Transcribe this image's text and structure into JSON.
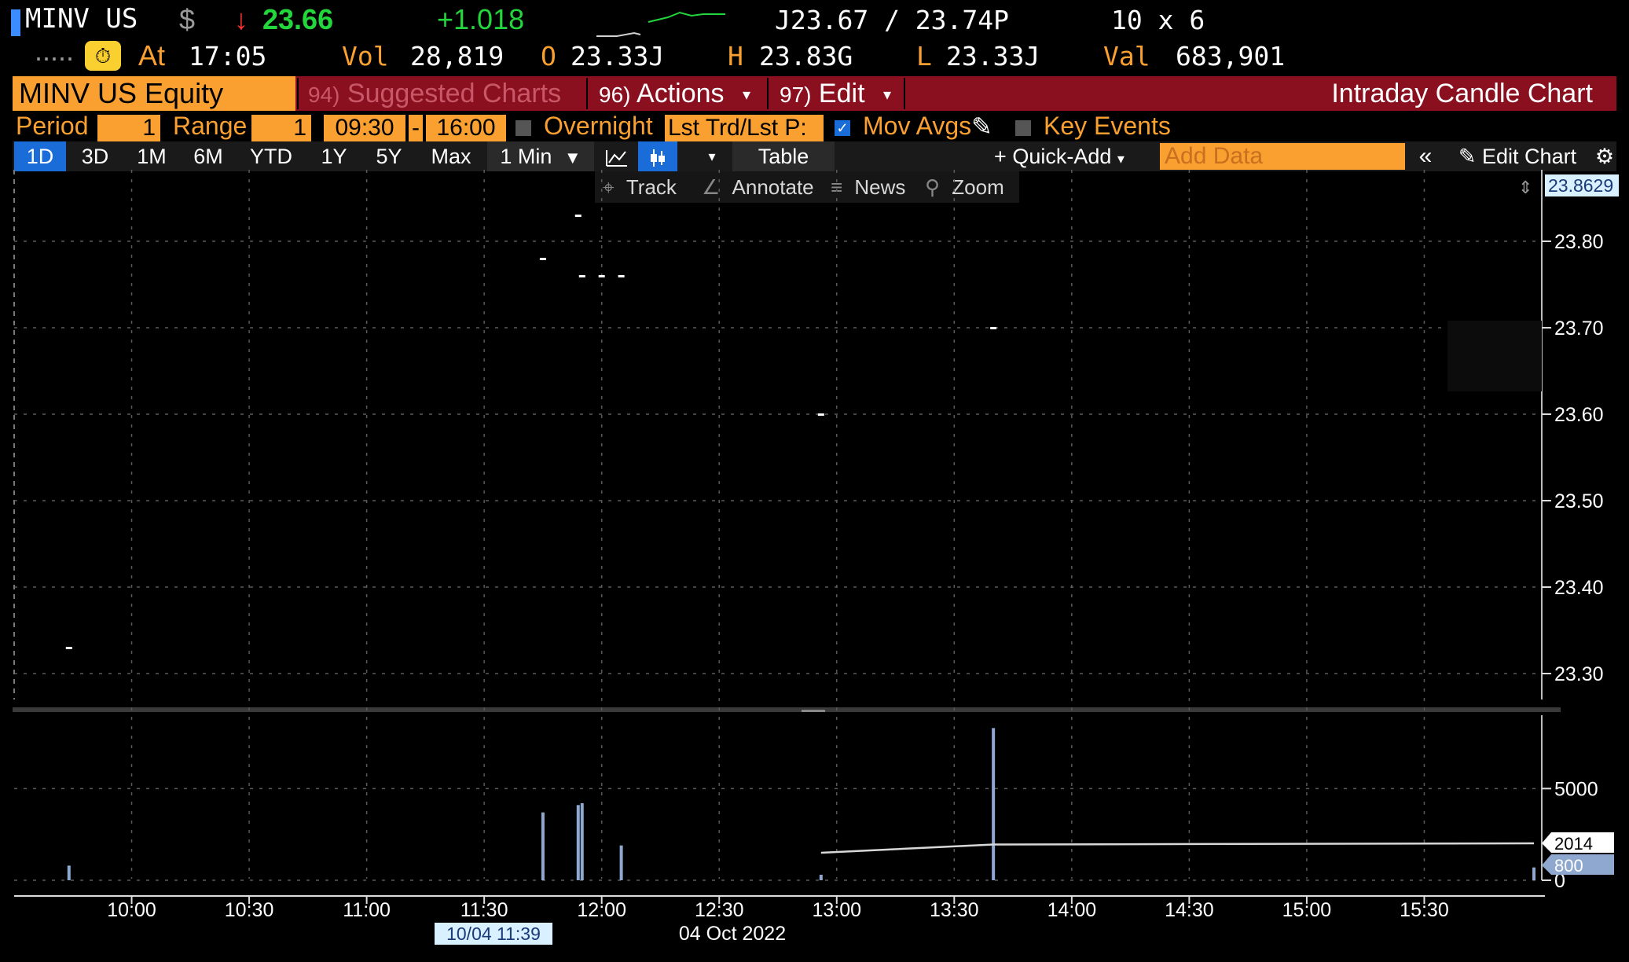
{
  "quote": {
    "ticker": "MINV US",
    "currency": "$",
    "direction_arrow": "↓",
    "last": "23.66",
    "change": "+1.018",
    "bid_ask": "J23.67 / 23.74P",
    "size": "10 x 6",
    "dots": ".....",
    "at_label": "At",
    "time": "17:05",
    "vol_label": "Vol",
    "volume": "28,819",
    "open_label": "O",
    "open": "23.33J",
    "high_label": "H",
    "high": "23.83G",
    "low_label": "L",
    "low": "23.33J",
    "val_label": "Val",
    "value": "683,901"
  },
  "function_bar": {
    "security": "MINV US Equity",
    "suggested_num": "94)",
    "suggested_label": "Suggested Charts",
    "actions_num": "96)",
    "actions_label": "Actions",
    "edit_num": "97)",
    "edit_label": "Edit",
    "title": "Intraday Candle Chart"
  },
  "settings": {
    "period_label": "Period",
    "period_value": "1",
    "range_label": "Range",
    "range_value": "1",
    "start_time": "09:30",
    "dash": "-",
    "end_time": "16:00",
    "overnight_label": "Overnight",
    "lst_trd_label": "Lst Trd/Lst P:",
    "mov_avgs_label": "Mov Avgs",
    "key_events_label": "Key Events"
  },
  "toolbar": {
    "ranges": [
      "1D",
      "3D",
      "1M",
      "6M",
      "YTD",
      "1Y",
      "5Y",
      "Max"
    ],
    "interval": "1 Min",
    "table_label": "Table",
    "quick_add_label": "Quick-Add",
    "add_data_placeholder": "Add Data",
    "edit_chart_label": "Edit Chart"
  },
  "chart_tools": {
    "track": "Track",
    "annotate": "Annotate",
    "news": "News",
    "zoom": "Zoom"
  },
  "colors": {
    "accent_orange": "#f9a030",
    "function_bar_red": "#8a1020",
    "active_blue": "#1a6cd8",
    "price_green": "#22d63c",
    "down_red": "#ff3030",
    "volume_bar": "#8fa8d0"
  },
  "chart_data": {
    "type": "bar",
    "date_label": "04 Oct 2022",
    "cursor_label": "10/04 11:39",
    "last_price_label": "23.8629",
    "price_axis": {
      "ticks": [
        23.3,
        23.4,
        23.5,
        23.6,
        23.7,
        23.8
      ],
      "tick_labels": [
        "23.30",
        "23.40",
        "23.50",
        "23.60",
        "23.70",
        "23.80"
      ],
      "range": [
        23.27,
        23.87
      ]
    },
    "volume_axis": {
      "ticks": [
        0,
        5000
      ],
      "tick_labels": [
        "0",
        "5000"
      ],
      "range": [
        0,
        9000
      ]
    },
    "time_axis": {
      "ticks": [
        "10:00",
        "10:30",
        "11:00",
        "11:30",
        "12:00",
        "12:30",
        "13:00",
        "13:30",
        "14:00",
        "14:30",
        "15:00",
        "15:30"
      ],
      "range_minutes": [
        570,
        960
      ]
    },
    "price_points": [
      {
        "t": 584,
        "p": 23.33
      },
      {
        "t": 705,
        "p": 23.78
      },
      {
        "t": 714,
        "p": 23.83
      },
      {
        "t": 715,
        "p": 23.76
      },
      {
        "t": 720,
        "p": 23.76
      },
      {
        "t": 725,
        "p": 23.76
      },
      {
        "t": 776,
        "p": 23.6
      },
      {
        "t": 820,
        "p": 23.7
      }
    ],
    "volume": [
      {
        "t": 584,
        "v": 800
      },
      {
        "t": 705,
        "v": 3700
      },
      {
        "t": 714,
        "v": 4100
      },
      {
        "t": 715,
        "v": 4200
      },
      {
        "t": 725,
        "v": 1900
      },
      {
        "t": 776,
        "v": 300
      },
      {
        "t": 820,
        "v": 8300
      },
      {
        "t": 958,
        "v": 700
      }
    ],
    "volume_ma": [
      {
        "t": 776,
        "v": 1500
      },
      {
        "t": 820,
        "v": 1950
      },
      {
        "t": 958,
        "v": 2014
      }
    ],
    "volume_labels": [
      "2014",
      "800"
    ]
  }
}
